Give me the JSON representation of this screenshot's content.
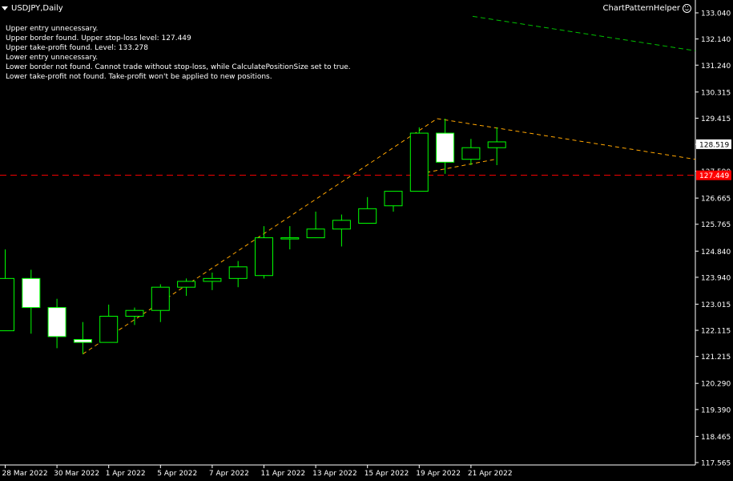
{
  "chart": {
    "symbol": "USDJPY,Daily",
    "indicator_name": "ChartPatternHelper",
    "messages": [
      "Upper entry unnecessary.",
      "Upper border found. Upper stop-loss level: 127.449",
      "Upper take-profit found. Level: 133.278",
      "Lower entry unnecessary.",
      "Lower border not found. Cannot trade without stop-loss, while CalculatePositionSize set to true.",
      "Lower take-profit not found. Take-profit won't be applied to new positions."
    ],
    "current_price_label": "128.519",
    "stop_loss_label": "127.449"
  },
  "chart_data": {
    "type": "candlestick",
    "title": "",
    "price_ticks": [
      "133.040",
      "132.140",
      "131.240",
      "130.315",
      "129.415",
      "128.515",
      "127.590",
      "126.665",
      "125.765",
      "124.840",
      "123.940",
      "123.015",
      "122.115",
      "121.215",
      "120.290",
      "119.390",
      "118.465",
      "117.565"
    ],
    "date_ticks": [
      "28 Mar 2022",
      "30 Mar 2022",
      "1 Apr 2022",
      "5 Apr 2022",
      "7 Apr 2022",
      "11 Apr 2022",
      "13 Apr 2022",
      "15 Apr 2022",
      "19 Apr 2022",
      "21 Apr 2022"
    ],
    "ylim": [
      117.5,
      133.3
    ],
    "candles": [
      {
        "o": 122.1,
        "h": 124.9,
        "l": 122.1,
        "c": 123.9
      },
      {
        "o": 123.9,
        "h": 124.2,
        "l": 122.0,
        "c": 122.9
      },
      {
        "o": 122.9,
        "h": 123.2,
        "l": 121.5,
        "c": 121.9
      },
      {
        "o": 121.8,
        "h": 122.4,
        "l": 121.3,
        "c": 121.7
      },
      {
        "o": 121.7,
        "h": 123.0,
        "l": 121.7,
        "c": 122.6
      },
      {
        "o": 122.6,
        "h": 122.9,
        "l": 122.3,
        "c": 122.8
      },
      {
        "o": 122.8,
        "h": 123.7,
        "l": 122.4,
        "c": 123.6
      },
      {
        "o": 123.6,
        "h": 123.9,
        "l": 123.3,
        "c": 123.8
      },
      {
        "o": 123.8,
        "h": 124.1,
        "l": 123.5,
        "c": 123.9
      },
      {
        "o": 123.9,
        "h": 124.5,
        "l": 123.6,
        "c": 124.3
      },
      {
        "o": 124.0,
        "h": 125.7,
        "l": 123.9,
        "c": 125.3
      },
      {
        "o": 125.3,
        "h": 125.7,
        "l": 124.9,
        "c": 125.3
      },
      {
        "o": 125.3,
        "h": 126.2,
        "l": 125.3,
        "c": 125.6
      },
      {
        "o": 125.6,
        "h": 126.1,
        "l": 125.0,
        "c": 125.9
      },
      {
        "o": 125.8,
        "h": 126.7,
        "l": 125.8,
        "c": 126.3
      },
      {
        "o": 126.4,
        "h": 126.9,
        "l": 126.2,
        "c": 126.9
      },
      {
        "o": 126.9,
        "h": 129.1,
        "l": 126.9,
        "c": 128.9
      },
      {
        "o": 128.9,
        "h": 129.4,
        "l": 127.5,
        "c": 127.9
      },
      {
        "o": 128.0,
        "h": 128.7,
        "l": 127.8,
        "c": 128.4
      },
      {
        "o": 128.4,
        "h": 129.1,
        "l": 127.8,
        "c": 128.6
      }
    ],
    "stop_loss_level": 127.449,
    "take_profit_level": 133.278,
    "current_price": 128.519,
    "colors": {
      "bull_body": "#000000",
      "bear_body": "#ffffff",
      "wick": "#00ff00",
      "stop_loss": "#ff0000",
      "upper_trend": "#ffa500",
      "tp_line": "#00c000"
    }
  }
}
